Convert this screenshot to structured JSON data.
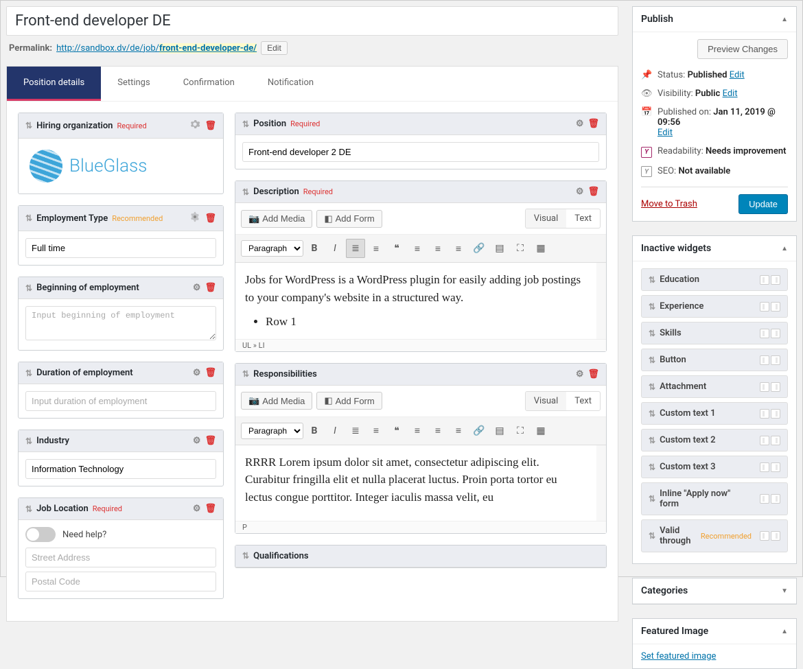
{
  "title": "Front-end developer DE",
  "permalink": {
    "label": "Permalink:",
    "base": "http://sandbox.dv/de/job/",
    "slug": "front-end-developer-de/",
    "edit": "Edit"
  },
  "tabs": [
    "Position details",
    "Settings",
    "Confirmation",
    "Notification"
  ],
  "active_tab": 0,
  "left": {
    "hiring_org": {
      "title": "Hiring organization",
      "badge": "Required",
      "logo_text": "BlueGlass"
    },
    "employment_type": {
      "title": "Employment Type",
      "badge": "Recommended",
      "value": "Full time"
    },
    "beginning": {
      "title": "Beginning of employment",
      "placeholder": "Input beginning of employment"
    },
    "duration": {
      "title": "Duration of employment",
      "placeholder": "Input duration of employment"
    },
    "industry": {
      "title": "Industry",
      "value": "Information Technology"
    },
    "location": {
      "title": "Job Location",
      "badge": "Required",
      "help": "Need help?",
      "street_ph": "Street Address",
      "postal_ph": "Postal Code"
    }
  },
  "right": {
    "position": {
      "title": "Position",
      "badge": "Required",
      "value": "Front-end developer 2 DE"
    },
    "description": {
      "title": "Description",
      "badge": "Required",
      "add_media": "Add Media",
      "add_form": "Add Form",
      "visual": "Visual",
      "text": "Text",
      "paragraph": "Paragraph",
      "content_p": "Jobs for WordPress is a WordPress plugin for easily adding job postings to your company's website in a structured way.",
      "content_li": "Row 1",
      "status": "UL » LI"
    },
    "responsibilities": {
      "title": "Responsibilities",
      "content": "RRRR Lorem ipsum dolor sit amet, consectetur adipiscing elit. Curabitur fringilla elit et nulla placerat luctus. Proin porta tortor eu lectus congue porttitor. Integer iaculis massa velit, eu",
      "status": "P"
    },
    "qualifications": {
      "title": "Qualifications"
    }
  },
  "publish": {
    "title": "Publish",
    "preview": "Preview Changes",
    "status_label": "Status:",
    "status_value": "Published",
    "edit": "Edit",
    "visibility_label": "Visibility:",
    "visibility_value": "Public",
    "published_label": "Published on:",
    "published_value": "Jan 11, 2019 @ 09:56",
    "readability_label": "Readability:",
    "readability_value": "Needs improvement",
    "seo_label": "SEO:",
    "seo_value": "Not available",
    "trash": "Move to Trash",
    "update": "Update"
  },
  "inactive_widgets": {
    "title": "Inactive widgets",
    "items": [
      {
        "label": "Education"
      },
      {
        "label": "Experience"
      },
      {
        "label": "Skills"
      },
      {
        "label": "Button"
      },
      {
        "label": "Attachment"
      },
      {
        "label": "Custom text 1"
      },
      {
        "label": "Custom text 2"
      },
      {
        "label": "Custom text 3"
      },
      {
        "label": "Inline \"Apply now\" form"
      },
      {
        "label": "Valid through",
        "badge": "Recommended"
      }
    ]
  },
  "categories": {
    "title": "Categories"
  },
  "featured_image": {
    "title": "Featured Image",
    "link": "Set featured image"
  }
}
